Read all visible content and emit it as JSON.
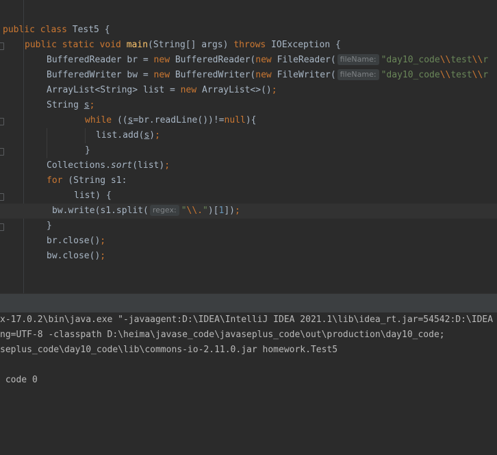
{
  "editor": {
    "lines": {
      "l1": {
        "kw1": "public class ",
        "name": "Test5 {"
      },
      "l2": {
        "kw1": "public static void ",
        "fn": "main",
        "mid": "(String[] args) ",
        "kw2": "throws",
        "rest": " IOException {"
      },
      "l3": {
        "a": "BufferedReader br = ",
        "kw1": "new",
        "b": " BufferedReader(",
        "kw2": "new",
        "c": " FileReader(",
        "hint": "fileName:",
        "str": "\"day10_code",
        "esc1": "\\\\",
        "str2": "test",
        "esc2": "\\\\",
        "str3": "r"
      },
      "l4": {
        "a": "BufferedWriter bw = ",
        "kw1": "new",
        "b": " BufferedWriter(",
        "kw2": "new",
        "c": " FileWriter(",
        "hint": "fileName:",
        "str": "\"day10_code",
        "esc1": "\\\\",
        "str2": "test",
        "esc2": "\\\\",
        "str3": "r"
      },
      "l5": {
        "a": "ArrayList<String> list = ",
        "kw1": "new",
        "b": " ArrayList<>()",
        "semi": ";"
      },
      "l6": {
        "a": "String ",
        "var": "s",
        "semi": ";"
      },
      "l7": {
        "kw1": "while",
        "a": " ((",
        "var": "s",
        "b": "=br.readLine())!=",
        "kw2": "null",
        "c": "){"
      },
      "l8": {
        "a": "list.add(",
        "var": "s",
        "b": ")",
        "semi": ";"
      },
      "l9": {
        "a": "}"
      },
      "l10": {
        "a": "Collections.",
        "it": "sort",
        "b": "(list)",
        "semi": ";"
      },
      "l11": {
        "kw1": "for",
        "a": " (String s1:"
      },
      "l12": {
        "a": "list) {"
      },
      "l13": {
        "a": "bw.write(s1.split(",
        "hint": "regex:",
        "str": "\"",
        "esc": "\\\\.",
        "str2": "\"",
        "b": ")[",
        "num": "1",
        "c": "])",
        "semi": ";"
      },
      "l14": {
        "a": "}"
      },
      "l15": {
        "a": "br.close()",
        "semi": ";"
      },
      "l16": {
        "a": "bw.close()",
        "semi": ";"
      }
    }
  },
  "console": {
    "line1": "x-17.0.2\\bin\\java.exe \"-javaagent:D:\\IDEA\\IntelliJ IDEA 2021.1\\lib\\idea_rt.jar=54542:D:\\IDEA",
    "line2": "ng=UTF-8 -classpath D:\\heima\\javase_code\\javaseplus_code\\out\\production\\day10_code;",
    "line3": "seplus_code\\day10_code\\lib\\commons-io-2.11.0.jar homework.Test5",
    "line4": " code 0"
  }
}
